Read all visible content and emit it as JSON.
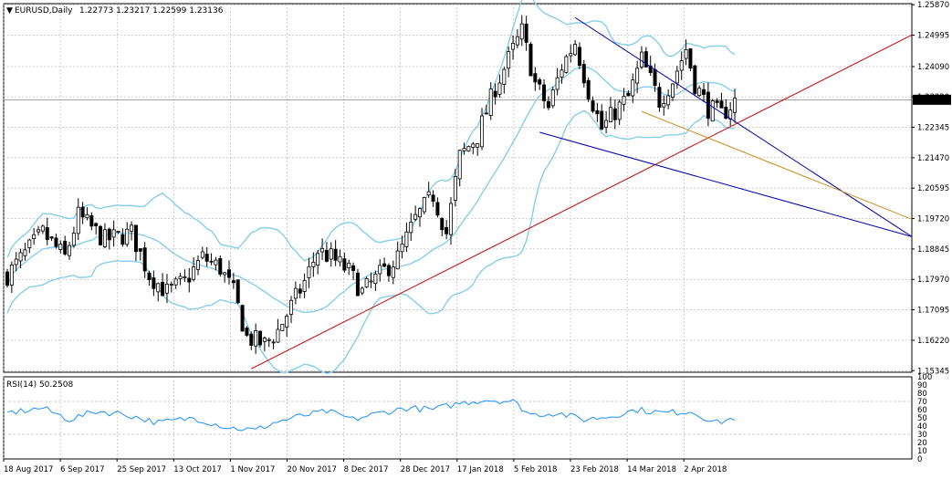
{
  "header": {
    "symbol_label": "EURUSD,Daily",
    "ohlc": "1.22773 1.23217 1.22599 1.23136"
  },
  "rsi_panel": {
    "label": "RSI(14) 50.2508",
    "levels": [
      "100",
      "90",
      "80",
      "70",
      "60",
      "50",
      "40",
      "30",
      "20",
      "10",
      "0"
    ]
  },
  "colors": {
    "background": "#ffffff",
    "grid": "#a0a0a0",
    "candle": "#000000",
    "bull_candle_fill": "#ffffff",
    "bollinger": "#87ceeb",
    "rsi_line": "#1e90ff",
    "trend_support": "#cc0000",
    "trend_channel": "#0000aa",
    "trend_midline": "#d08a20",
    "price_tag_bg": "#000000",
    "price_tag_text": "#ffffff"
  },
  "chart_data": {
    "type": "candlestick",
    "current_price": "1.23136",
    "price_axis_labels": [
      "1.25870",
      "1.24995",
      "1.24090",
      "1.23220",
      "1.22345",
      "1.21470",
      "1.20595",
      "1.19720",
      "1.18845",
      "1.17970",
      "1.17095",
      "1.16220",
      "1.15345"
    ],
    "date_axis_labels": [
      "18 Aug 2017",
      "6 Sep 2017",
      "25 Sep 2017",
      "13 Oct 2017",
      "1 Nov 2017",
      "20 Nov 2017",
      "8 Dec 2017",
      "28 Dec 2017",
      "17 Jan 2018",
      "5 Feb 2018",
      "23 Feb 2018",
      "14 Mar 2018",
      "2 Apr 2018"
    ],
    "ylim": [
      1.153,
      1.259
    ],
    "n_bars": 165,
    "close_anchors": [
      [
        0,
        1.181
      ],
      [
        8,
        1.193
      ],
      [
        13,
        1.186
      ],
      [
        16,
        1.198
      ],
      [
        22,
        1.191
      ],
      [
        28,
        1.193
      ],
      [
        32,
        1.181
      ],
      [
        36,
        1.176
      ],
      [
        40,
        1.179
      ],
      [
        44,
        1.186
      ],
      [
        48,
        1.183
      ],
      [
        51,
        1.176
      ],
      [
        54,
        1.163
      ],
      [
        58,
        1.161
      ],
      [
        61,
        1.165
      ],
      [
        64,
        1.172
      ],
      [
        67,
        1.179
      ],
      [
        70,
        1.188
      ],
      [
        73,
        1.186
      ],
      [
        77,
        1.182
      ],
      [
        80,
        1.176
      ],
      [
        84,
        1.181
      ],
      [
        88,
        1.186
      ],
      [
        92,
        1.197
      ],
      [
        96,
        1.204
      ],
      [
        99,
        1.193
      ],
      [
        102,
        1.215
      ],
      [
        106,
        1.221
      ],
      [
        110,
        1.235
      ],
      [
        113,
        1.243
      ],
      [
        116,
        1.251
      ],
      [
        119,
        1.236
      ],
      [
        122,
        1.229
      ],
      [
        125,
        1.241
      ],
      [
        128,
        1.248
      ],
      [
        131,
        1.234
      ],
      [
        134,
        1.223
      ],
      [
        137,
        1.228
      ],
      [
        140,
        1.232
      ],
      [
        143,
        1.243
      ],
      [
        147,
        1.231
      ],
      [
        150,
        1.237
      ],
      [
        153,
        1.246
      ],
      [
        155,
        1.236
      ],
      [
        158,
        1.229
      ],
      [
        161,
        1.227
      ],
      [
        164,
        1.231
      ]
    ],
    "rsi_anchors": [
      [
        0,
        56
      ],
      [
        8,
        62
      ],
      [
        14,
        48
      ],
      [
        20,
        58
      ],
      [
        26,
        55
      ],
      [
        34,
        44
      ],
      [
        42,
        50
      ],
      [
        50,
        38
      ],
      [
        56,
        35
      ],
      [
        60,
        44
      ],
      [
        66,
        52
      ],
      [
        72,
        58
      ],
      [
        78,
        48
      ],
      [
        84,
        56
      ],
      [
        90,
        62
      ],
      [
        96,
        60
      ],
      [
        102,
        68
      ],
      [
        108,
        72
      ],
      [
        114,
        70
      ],
      [
        118,
        54
      ],
      [
        124,
        56
      ],
      [
        130,
        48
      ],
      [
        136,
        52
      ],
      [
        142,
        60
      ],
      [
        148,
        56
      ],
      [
        154,
        58
      ],
      [
        160,
        44
      ],
      [
        164,
        50
      ]
    ],
    "rsi_ylim": [
      0,
      100
    ],
    "trendlines": [
      {
        "role": "support",
        "from": [
          55,
          1.154
        ],
        "to": [
          210,
          1.25
        ]
      },
      {
        "role": "channel_upper",
        "from": [
          128,
          1.255
        ],
        "to": [
          210,
          1.192
        ]
      },
      {
        "role": "channel_lower",
        "from": [
          120,
          1.222
        ],
        "to": [
          210,
          1.192
        ]
      },
      {
        "role": "midline",
        "from": [
          143,
          1.228
        ],
        "to": [
          210,
          1.197
        ]
      }
    ],
    "grid": true
  }
}
